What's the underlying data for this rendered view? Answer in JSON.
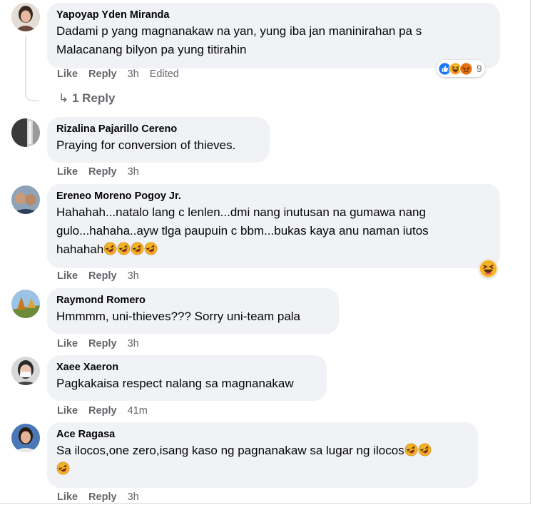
{
  "colors": {
    "bubble": "#f0f2f5",
    "meta": "#65676b",
    "like_blue": "#1877f2",
    "haha_yellow": "#f7b125",
    "angry_orange": "#e9710f"
  },
  "comments": [
    {
      "author": "Yapoyap Yden Miranda",
      "lines": [
        "Dadami p yang magnanakaw na yan, yung iba jan maninirahan pa s",
        "Malacanang bilyon pa yung titirahin"
      ],
      "actions": {
        "like": "Like",
        "reply": "Reply",
        "time": "3h",
        "edited": "Edited"
      },
      "reactions": {
        "icons": [
          "like-icon",
          "haha-icon",
          "angry-icon"
        ],
        "count": "9"
      },
      "replies_link": "1 Reply"
    },
    {
      "author": "Rizalina Pajarillo Cereno",
      "lines": [
        "Praying for conversion of thieves."
      ],
      "actions": {
        "like": "Like",
        "reply": "Reply",
        "time": "3h"
      }
    },
    {
      "author": "Ereneo Moreno Pogoy Jr.",
      "lines": [
        "Hahahah...natalo lang c lenlen...dmi nang inutusan na gumawa nang",
        "gulo...hahaha..ayw tlga paupuin c bbm...bukas kaya anu naman iutos",
        "hahahah"
      ],
      "actions": {
        "like": "Like",
        "reply": "Reply",
        "time": "3h"
      },
      "reactions": {
        "icons": [
          "haha-icon"
        ]
      }
    },
    {
      "author": "Raymond Romero",
      "lines": [
        "Hmmmm, uni-thieves??? Sorry uni-team pala"
      ],
      "actions": {
        "like": "Like",
        "reply": "Reply",
        "time": "3h"
      }
    },
    {
      "author": "Xaee Xaeron",
      "lines": [
        "Pagkakaisa respect nalang sa magnanakaw"
      ],
      "actions": {
        "like": "Like",
        "reply": "Reply",
        "time": "41m"
      }
    },
    {
      "author": "Ace Ragasa",
      "lines": [
        "Sa ilocos,one zero,isang kaso ng pagnanakaw sa lugar ng ilocos"
      ],
      "actions": {
        "like": "Like",
        "reply": "Reply",
        "time": "3h"
      }
    }
  ]
}
